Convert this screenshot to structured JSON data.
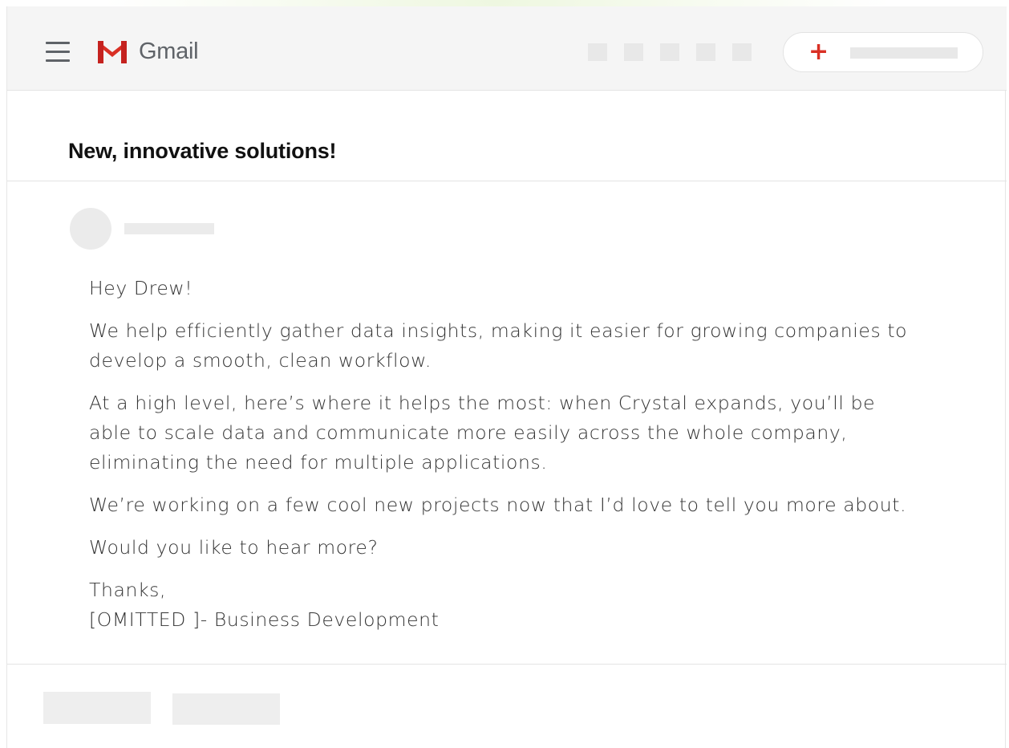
{
  "app": {
    "name": "Gmail",
    "brand_color": "#d93025",
    "icons": {
      "menu": "hamburger-menu-icon",
      "logo": "gmail-m-logo-icon",
      "compose": "plus-icon"
    }
  },
  "email": {
    "subject": "New, innovative solutions!",
    "greeting": "Hey Drew!",
    "paragraphs": [
      "We help efficiently gather data insights, making it easier for growing companies to develop a smooth, clean workflow.",
      "At a high level, here’s where it helps the most: when Crystal expands, you’ll be able to scale data and communicate more easily across the whole company, eliminating the need for multiple applications.",
      "We’re working on a few cool new projects now that I’d love to tell you more about.",
      "Would you like to hear more?"
    ],
    "signoff": "Thanks,",
    "signature": "[OMITTED ]- Business Development"
  }
}
